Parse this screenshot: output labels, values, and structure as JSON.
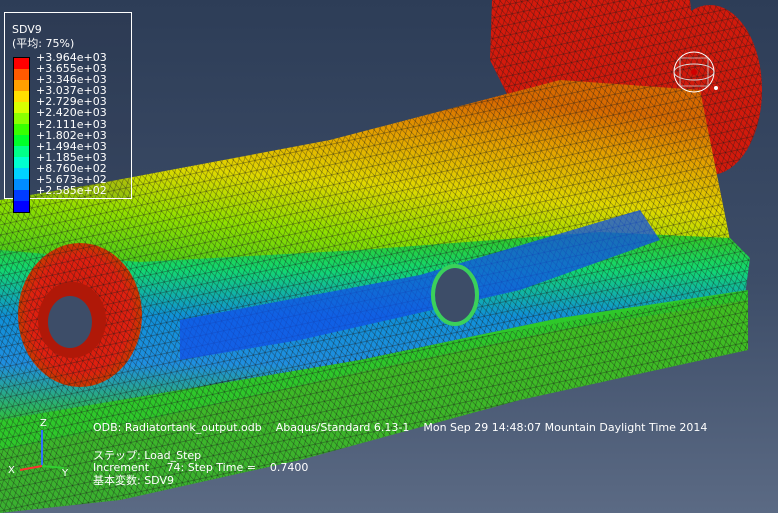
{
  "legend": {
    "title": "SDV9",
    "subtitle": "(平均: 75%)",
    "colors": [
      "#ff0000",
      "#ff5a00",
      "#ff9f00",
      "#ffdf00",
      "#d8ff00",
      "#8bff00",
      "#38ff00",
      "#00ff2a",
      "#00ff88",
      "#00ffd0",
      "#00d2ff",
      "#008cff",
      "#003cff",
      "#0000ff"
    ],
    "labels": [
      "+3.964e+03",
      "+3.655e+03",
      "+3.346e+03",
      "+3.037e+03",
      "+2.729e+03",
      "+2.420e+03",
      "+2.111e+03",
      "+1.802e+03",
      "+1.494e+03",
      "+1.185e+03",
      "+8.760e+02",
      "+5.673e+02",
      "+2.585e+02"
    ]
  },
  "info": {
    "odb_line": "ODB: Radiatortank_output.odb    Abaqus/Standard 6.13-1    Mon Sep 29 14:48:07 Mountain Daylight Time 2014",
    "step_line": "ステップ: Load_Step",
    "increment_line": "Increment     74: Step Time =    0.7400",
    "variable_line": "基本変数: SDV9"
  },
  "triad": {
    "z": "Z",
    "x": "X",
    "y": "Y"
  },
  "colors": {
    "background_top": "#2d3d57",
    "background_bottom": "#5b6a84",
    "mesh": "#1a1a1a"
  }
}
